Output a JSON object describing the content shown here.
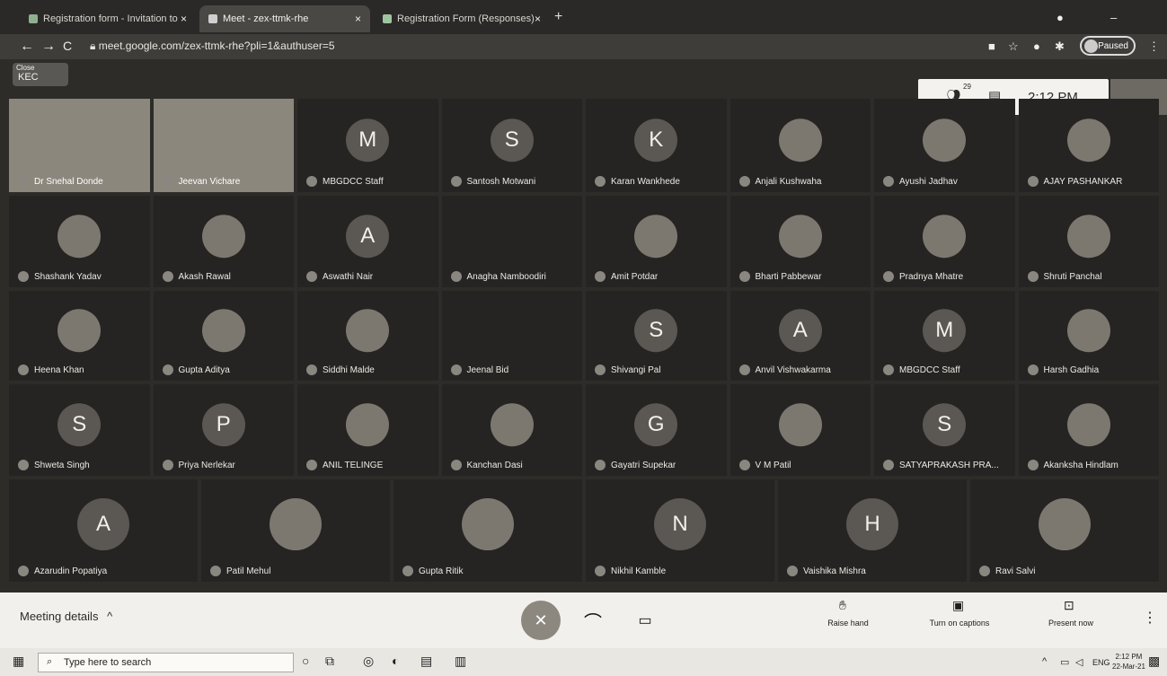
{
  "browser": {
    "tabs": [
      {
        "label": "Registration form - Invitation to",
        "close": "×"
      },
      {
        "label": "Meet - zex-ttmk-rhe",
        "close": "×"
      },
      {
        "label": "Registration Form (Responses)",
        "close": "×"
      }
    ],
    "new_tab": "+",
    "url": "meet.google.com/zex-ttmk-rhe?pli=1&authuser=5",
    "paused_label": "Paused"
  },
  "meet": {
    "close_badge_small": "Close",
    "close_badge": "KEC",
    "participant_count": "29",
    "clock": "2:12 PM",
    "participants": [
      {
        "name": "Dr Snehal Donde",
        "kind": "video"
      },
      {
        "name": "Jeevan Vichare",
        "kind": "video"
      },
      {
        "name": "MBGDCC Staff",
        "kind": "letter",
        "initial": "M"
      },
      {
        "name": "Santosh Motwani",
        "kind": "letter",
        "initial": "S"
      },
      {
        "name": "Karan Wankhede",
        "kind": "letter",
        "initial": "K"
      },
      {
        "name": "Anjali Kushwaha",
        "kind": "photo"
      },
      {
        "name": "Ayushi Jadhav",
        "kind": "photo"
      },
      {
        "name": "AJAY PASHANKAR",
        "kind": "photo"
      },
      {
        "name": "Shashank Yadav",
        "kind": "photo"
      },
      {
        "name": "Akash Rawal",
        "kind": "photo"
      },
      {
        "name": "Aswathi Nair",
        "kind": "letter",
        "initial": "A"
      },
      {
        "name": "Anagha Namboodiri",
        "kind": "none"
      },
      {
        "name": "Amit Potdar",
        "kind": "photo"
      },
      {
        "name": "Bharti Pabbewar",
        "kind": "photo"
      },
      {
        "name": "Pradnya Mhatre",
        "kind": "photo"
      },
      {
        "name": "Shruti Panchal",
        "kind": "photo"
      },
      {
        "name": "Heena Khan",
        "kind": "photo"
      },
      {
        "name": "Gupta Aditya",
        "kind": "photo"
      },
      {
        "name": "Siddhi Malde",
        "kind": "photo"
      },
      {
        "name": "Jeenal Bid",
        "kind": "none"
      },
      {
        "name": "Shivangi Pal",
        "kind": "letter",
        "initial": "S"
      },
      {
        "name": "Anvil Vishwakarma",
        "kind": "letter",
        "initial": "A"
      },
      {
        "name": "MBGDCC Staff",
        "kind": "letter",
        "initial": "M"
      },
      {
        "name": "Harsh Gadhia",
        "kind": "photo"
      },
      {
        "name": "Shweta Singh",
        "kind": "letter",
        "initial": "S"
      },
      {
        "name": "Priya Nerlekar",
        "kind": "letter",
        "initial": "P"
      },
      {
        "name": "ANIL TELINGE",
        "kind": "photo"
      },
      {
        "name": "Kanchan Dasi",
        "kind": "photo"
      },
      {
        "name": "Gayatri Supekar",
        "kind": "letter",
        "initial": "G"
      },
      {
        "name": "V M Patil",
        "kind": "photo"
      },
      {
        "name": "SATYAPRAKASH PRA...",
        "kind": "letter",
        "initial": "S"
      },
      {
        "name": "Akanksha Hindlam",
        "kind": "photo"
      },
      {
        "name": "Azarudin Popatiya",
        "kind": "letter",
        "initial": "A"
      },
      {
        "name": "Patil Mehul",
        "kind": "photo"
      },
      {
        "name": "Gupta Ritik",
        "kind": "photo"
      },
      {
        "name": "Nikhil Kamble",
        "kind": "letter",
        "initial": "N"
      },
      {
        "name": "Vaishika Mishra",
        "kind": "letter",
        "initial": "H"
      },
      {
        "name": "Ravi Salvi",
        "kind": "photo"
      }
    ],
    "meeting_details": "Meeting details",
    "meeting_details_chevron": "^",
    "raise_hand": "Raise hand",
    "captions": "Turn on captions",
    "present": "Present now",
    "more": "⋮"
  },
  "taskbar": {
    "search_placeholder": "Type here to search",
    "time": "2:12 PM",
    "date": "22-Mar-21",
    "lang": "ENG"
  },
  "colors": {
    "meet_bg": "#2e2c29",
    "end_call": "#f2f0ec",
    "mic_off": "#8c8880"
  }
}
